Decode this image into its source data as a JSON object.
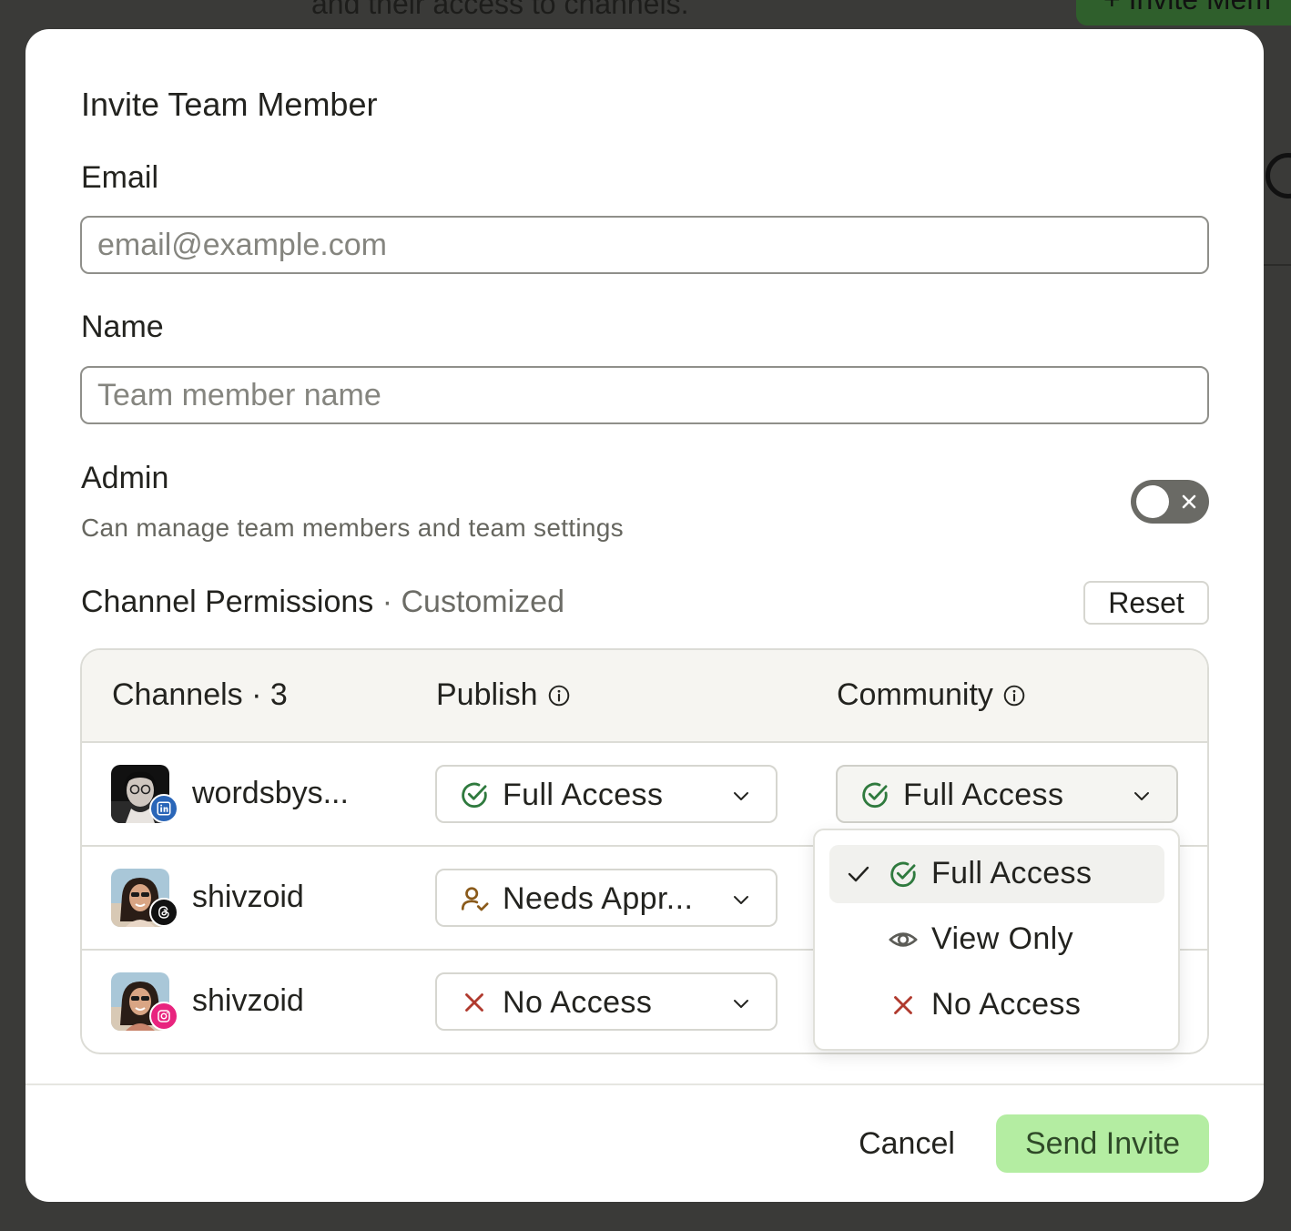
{
  "background": {
    "subtitle_fragment": "and their access to channels.",
    "invite_button_fragment": "+ Invite Mem"
  },
  "modal": {
    "title": "Invite Team Member",
    "email": {
      "label": "Email",
      "placeholder": "email@example.com",
      "value": ""
    },
    "name": {
      "label": "Name",
      "placeholder": "Team member name",
      "value": ""
    },
    "admin": {
      "label": "Admin",
      "description": "Can manage team members and team settings",
      "enabled": false
    },
    "permissions": {
      "title": "Channel Permissions",
      "separator": " · ",
      "status": "Customized",
      "reset_label": "Reset",
      "columns": {
        "channels": "Channels · 3",
        "publish": "Publish",
        "community": "Community"
      },
      "rows": [
        {
          "name": "wordsbys...",
          "platform": "linkedin-icon",
          "publish": "Full Access",
          "community": "Full Access"
        },
        {
          "name": "shivzoid",
          "platform": "threads-icon",
          "publish": "Needs Appr...",
          "community": ""
        },
        {
          "name": "shivzoid",
          "platform": "instagram-icon",
          "publish": "No Access",
          "community": ""
        }
      ],
      "dropdown_options": [
        {
          "label": "Full Access",
          "icon": "check-circle-icon",
          "selected": true
        },
        {
          "label": "View Only",
          "icon": "eye-icon",
          "selected": false
        },
        {
          "label": "No Access",
          "icon": "x-icon",
          "selected": false
        }
      ]
    },
    "footer": {
      "cancel_label": "Cancel",
      "send_label": "Send Invite"
    }
  },
  "colors": {
    "accent_green": "#2f7a3e",
    "send_button_bg": "#b4eda2",
    "no_access_red": "#b03a2e",
    "needs_approval_brown": "#8a5a1a",
    "linkedin_blue": "#2a66b8",
    "instagram_pink": "#e8247e"
  }
}
